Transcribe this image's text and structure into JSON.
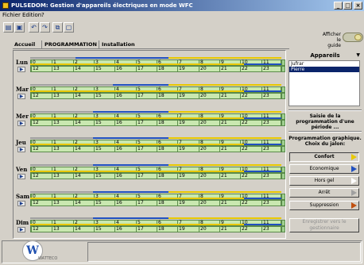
{
  "window": {
    "title": "PULSEDOM: Gestion d'appareils électriques en mode WFC",
    "buttons": {
      "minimize": "_",
      "maximize": "□",
      "close": "×"
    }
  },
  "menu": {
    "items": [
      "Fichier",
      "Edition",
      "?"
    ]
  },
  "toolbar": {
    "icons": [
      "open-icon",
      "save-icon",
      "undo-icon",
      "redo-icon",
      "copy-icon",
      "paste-icon"
    ]
  },
  "help": {
    "label": "Afficher\nle guide"
  },
  "tabs": [
    "Accueil",
    "PROGRAMMATION",
    "Installation"
  ],
  "hours_top": [
    "0",
    "1",
    "2",
    "3",
    "4",
    "5",
    "6",
    "7",
    "8",
    "9",
    "10",
    "11"
  ],
  "hours_bottom": [
    "12",
    "13",
    "14",
    "15",
    "16",
    "17",
    "18",
    "19",
    "20",
    "21",
    "22",
    "23"
  ],
  "days": [
    {
      "label": "Lun"
    },
    {
      "label": "Mar"
    },
    {
      "label": "Mer"
    },
    {
      "label": "Jeu"
    },
    {
      "label": "Ven"
    },
    {
      "label": "Sam"
    },
    {
      "label": "Dim"
    }
  ],
  "sidebar": {
    "header": "Appareils",
    "appliances": [
      "Jufrar",
      "Pierre"
    ],
    "selected_index": 1,
    "period_note": "Saisie de la programmation d'une période ...",
    "graph_note": "Programmation graphique. Choix du jalon:",
    "modes": [
      {
        "label": "Confort",
        "color": "#e8c800"
      },
      {
        "label": "Economique",
        "color": "#2050c0"
      },
      {
        "label": "Hors gel",
        "color": "#ffffff"
      },
      {
        "label": "Arrêt",
        "color": "#a0a0a0"
      },
      {
        "label": "Suppression",
        "color": "#c05010"
      }
    ],
    "save_button": "Enregistrer vers le gestionnaire"
  },
  "logo": {
    "text": "WATTECO"
  },
  "colors": {
    "confort": "#e8c800",
    "economique": "#2050c0",
    "track": "#c9e8b0",
    "grey": "#a0a0a0"
  }
}
